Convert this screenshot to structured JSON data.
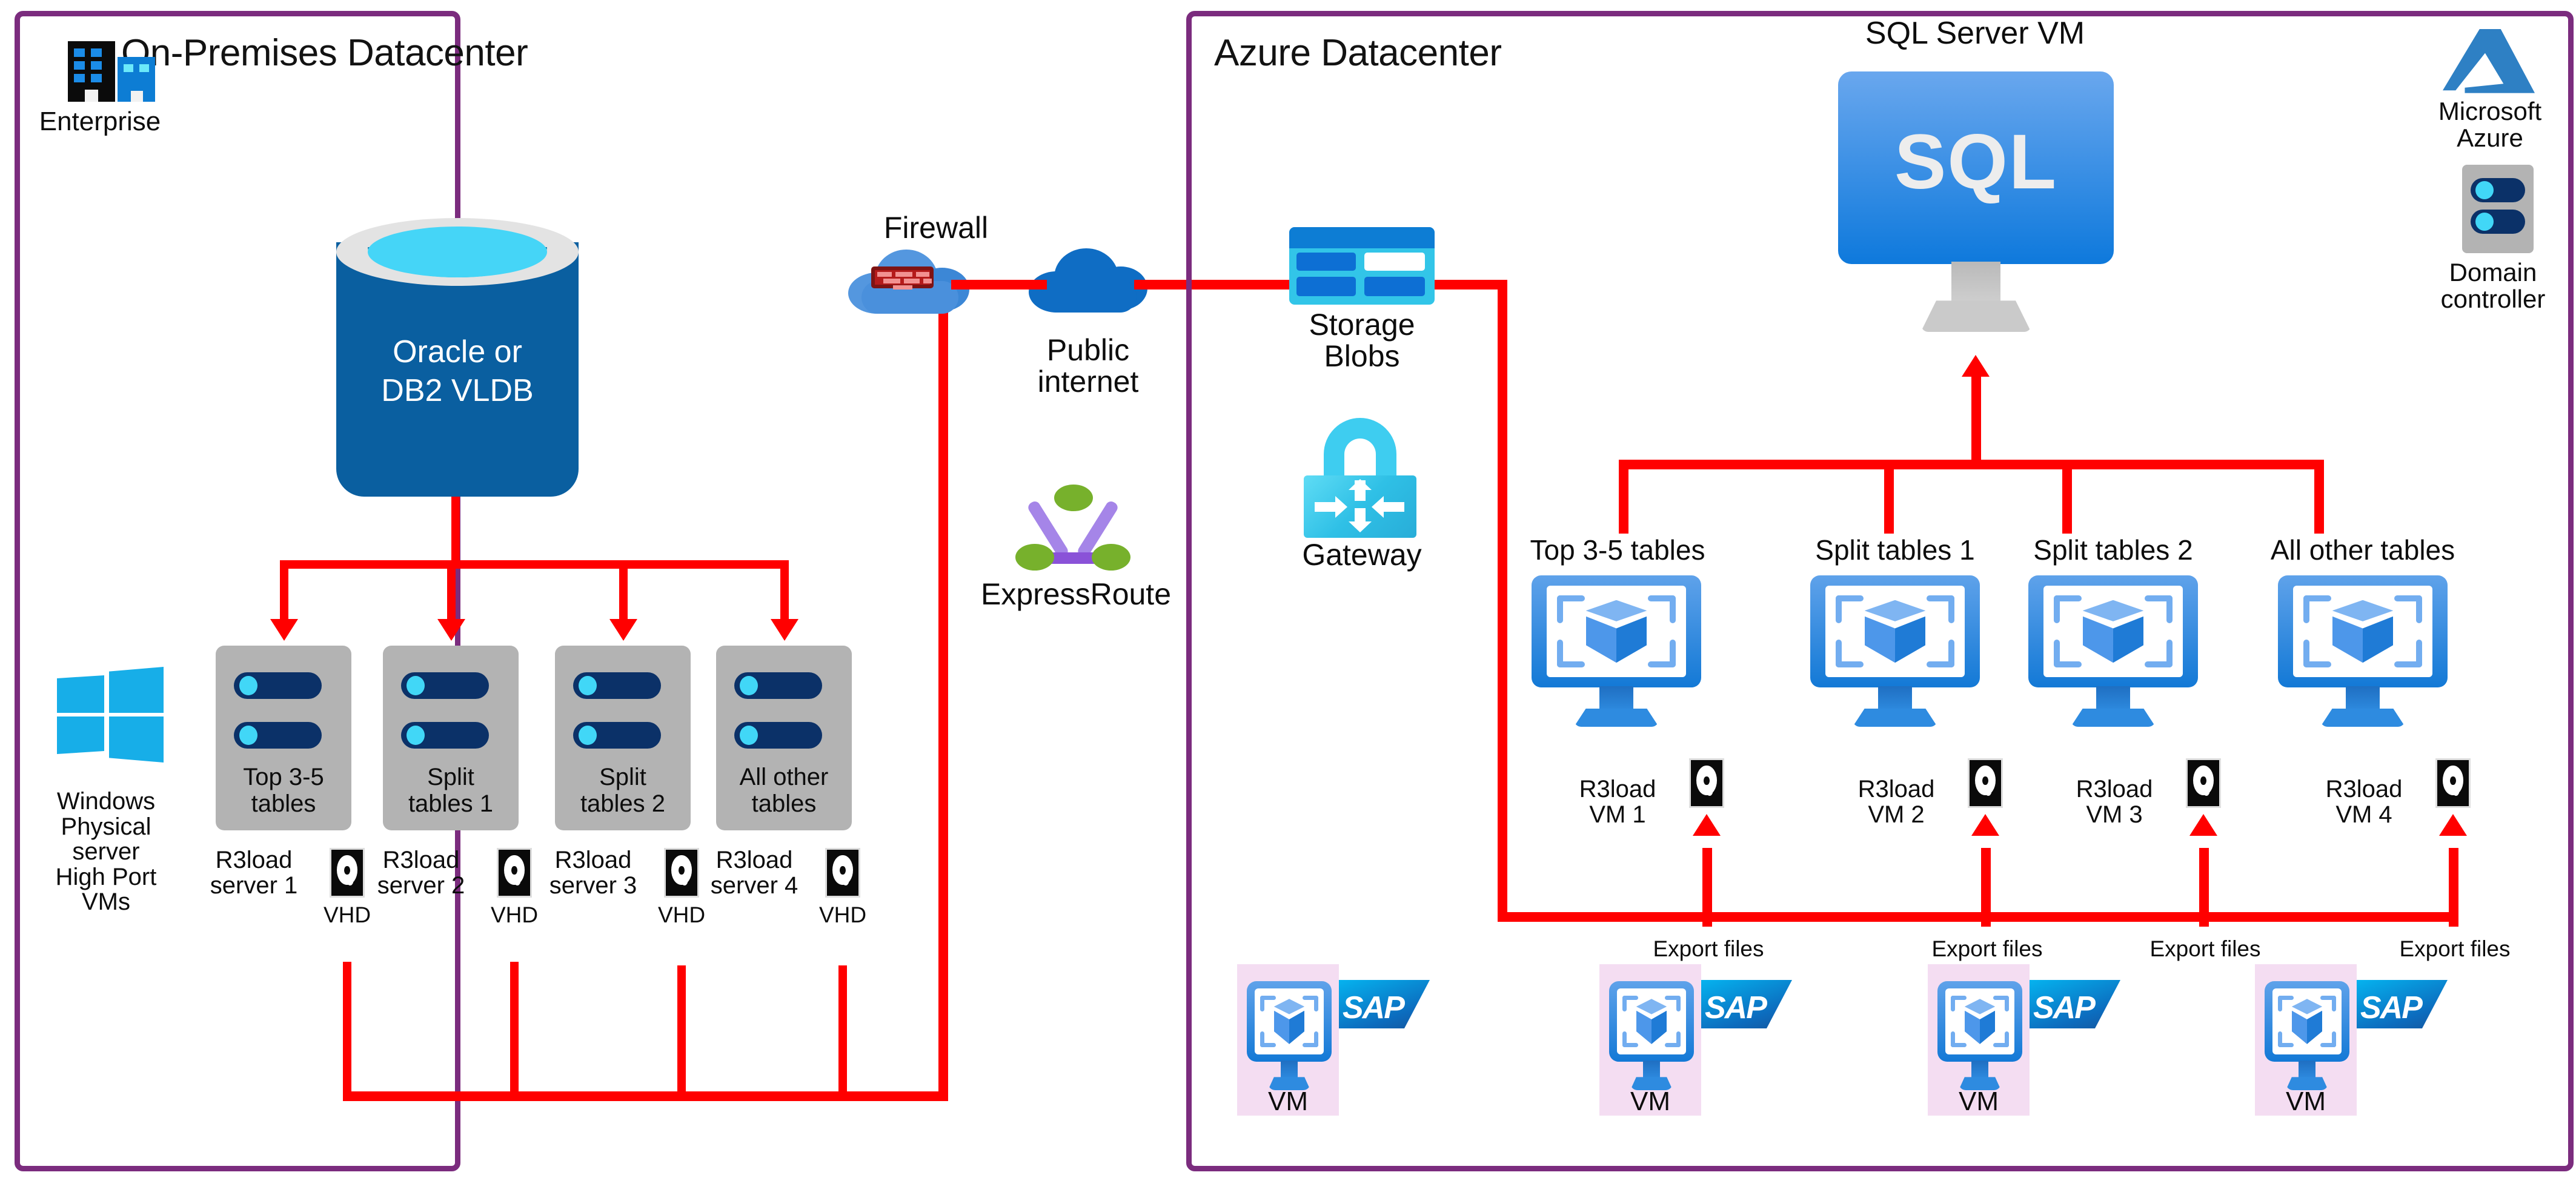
{
  "panels": {
    "onprem": {
      "title": "On-Premises Datacenter"
    },
    "azure": {
      "title": "Azure Datacenter"
    }
  },
  "onprem": {
    "enterprise_label": "Enterprise",
    "database_line1": "Oracle or",
    "database_line2": "DB2 VLDB",
    "windows_label": "Windows\nPhysical\nserver\nHigh Port\nVMs",
    "windows_label_lines": [
      "Windows",
      "Physical",
      "server",
      "High Port",
      "VMs"
    ],
    "racks": [
      {
        "label_line1": "Top 3-5",
        "label_line2": "tables",
        "server_line1": "R3load",
        "server_line2": "server 1",
        "vhd_label": "VHD"
      },
      {
        "label_line1": "Split",
        "label_line2": "tables 1",
        "server_line1": "R3load",
        "server_line2": "server 2",
        "vhd_label": "VHD"
      },
      {
        "label_line1": "Split",
        "label_line2": "tables 2",
        "server_line1": "R3load",
        "server_line2": "server 3",
        "vhd_label": "VHD"
      },
      {
        "label_line1": "All other",
        "label_line2": "tables",
        "server_line1": "R3load",
        "server_line2": "server 4",
        "vhd_label": "VHD"
      }
    ]
  },
  "middle": {
    "firewall_label": "Firewall",
    "internet_line1": "Public",
    "internet_line2": "internet",
    "expressroute_label": "ExpressRoute"
  },
  "azure": {
    "storage_line1": "Storage",
    "storage_line2": "Blobs",
    "gateway_label": "Gateway",
    "sql_title": "SQL Server VM",
    "sql_text": "SQL",
    "azure_logo_line1": "Microsoft",
    "azure_logo_line2": "Azure",
    "domain_line1": "Domain",
    "domain_line2": "controller",
    "vms": [
      {
        "title": "Top 3-5 tables",
        "name_line1": "R3load",
        "name_line2": "VM 1",
        "export_label": "Export files"
      },
      {
        "title": "Split tables 1",
        "name_line1": "R3load",
        "name_line2": "VM 2",
        "export_label": "Export files"
      },
      {
        "title": "Split tables 2",
        "name_line1": "R3load",
        "name_line2": "VM 3",
        "export_label": "Export files"
      },
      {
        "title": "All other tables",
        "name_line1": "R3load",
        "name_line2": "VM 4",
        "export_label": "Export files"
      }
    ],
    "sap_vms": [
      {
        "vm_label": "VM",
        "logo_label": "SAP"
      },
      {
        "vm_label": "VM",
        "logo_label": "SAP"
      },
      {
        "vm_label": "VM",
        "logo_label": "SAP"
      },
      {
        "vm_label": "VM",
        "logo_label": "SAP"
      }
    ]
  },
  "colors": {
    "panel_border": "#7B2C7E",
    "flow_arrow": "#FF0000",
    "rack_body": "#B3B3B3",
    "db_body": "#0A5FA0",
    "azure_blue": "#1379D6",
    "sap_bg": "#F4DDF2"
  }
}
